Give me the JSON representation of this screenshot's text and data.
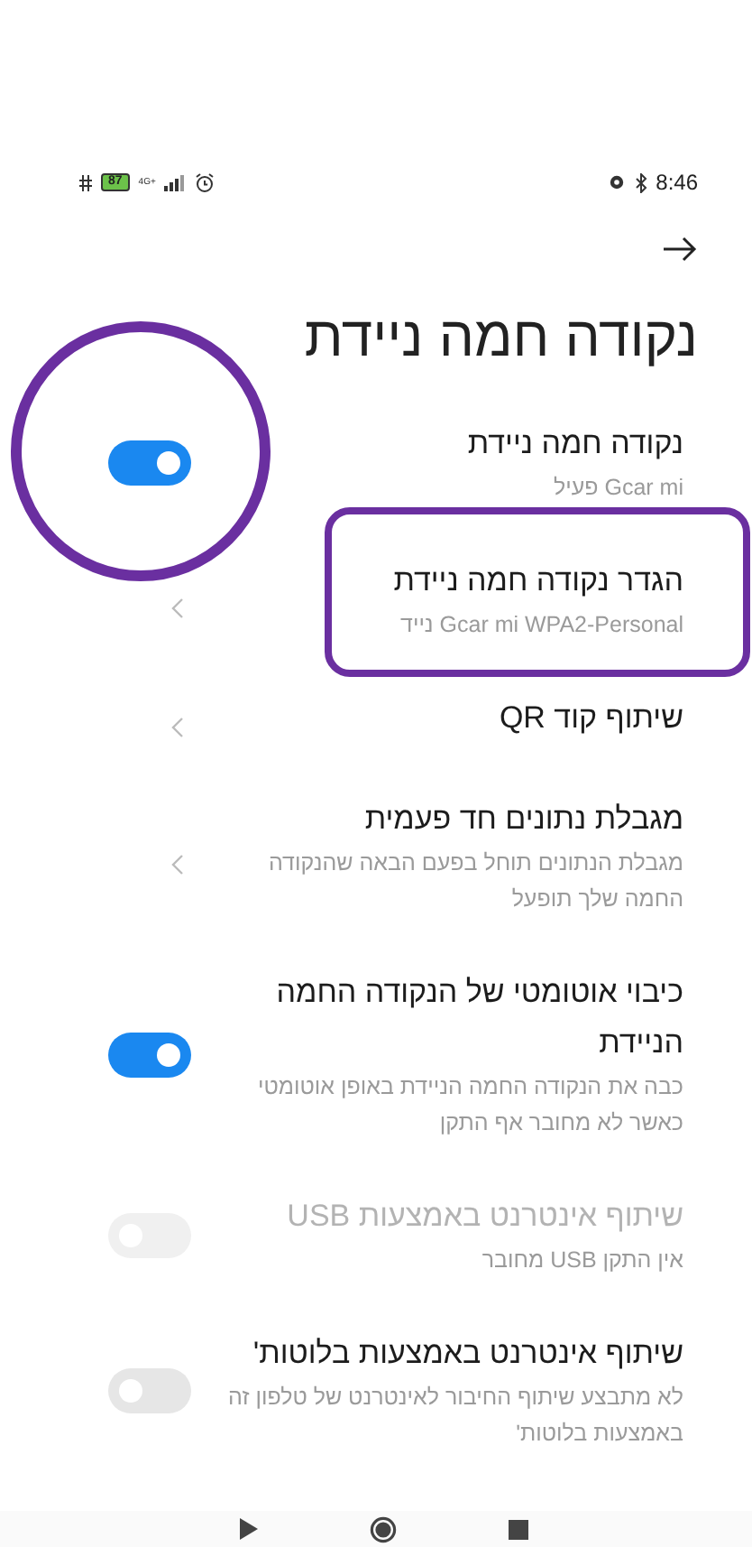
{
  "status_bar": {
    "battery": "87",
    "network": "4G+",
    "time": "8:46"
  },
  "title": "נקודה חמה ניידת",
  "rows": [
    {
      "kind": "toggle",
      "title": "נקודה חמה ניידת",
      "subtitle": "Gcar mi פעיל",
      "on": true,
      "disabled": false
    },
    {
      "kind": "link",
      "title": "הגדר נקודה חמה ניידת",
      "subtitle": "Gcar mi WPA2-Personal נייד"
    },
    {
      "kind": "link",
      "title": "שיתוף קוד QR"
    },
    {
      "kind": "link",
      "title": "מגבלת נתונים חד פעמית",
      "subtitle": "מגבלת הנתונים תוחל בפעם הבאה שהנקודה החמה שלך תופעל"
    },
    {
      "kind": "toggle",
      "title": "כיבוי אוטומטי של הנקודה החמה הניידת",
      "subtitle": "כבה את הנקודה החמה הניידת באופן אוטומטי כאשר לא מחובר אף התקן",
      "on": true,
      "disabled": false
    },
    {
      "kind": "toggle",
      "title": "שיתוף אינטרנט באמצעות USB",
      "subtitle": "אין התקן USB מחובר",
      "on": false,
      "disabled": true
    },
    {
      "kind": "toggle",
      "title": "שיתוף אינטרנט באמצעות בלוטות'",
      "subtitle": "לא מתבצע שיתוף החיבור לאינטרנט של טלפון זה באמצעות בלוטות'",
      "on": false,
      "disabled": false
    }
  ]
}
